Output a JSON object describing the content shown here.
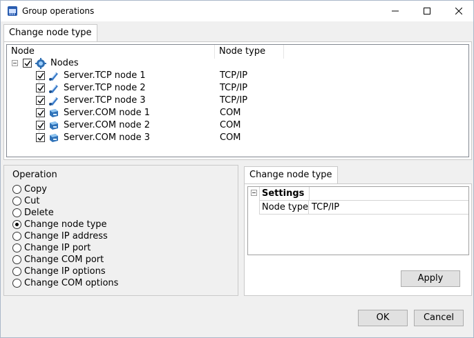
{
  "window": {
    "title": "Group operations",
    "icon": "network-app-icon",
    "controls": [
      "minimize-icon",
      "maximize-icon",
      "close-icon"
    ]
  },
  "top_tab": {
    "label": "Change node type"
  },
  "tree": {
    "columns": [
      "Node",
      "Node type"
    ],
    "root": {
      "label": "Nodes",
      "checked": true,
      "expanded": true
    },
    "children": [
      {
        "label": "Server.TCP node 1",
        "type": "TCP/IP",
        "checked": true,
        "icon": "tcp-node-icon"
      },
      {
        "label": "Server.TCP node 2",
        "type": "TCP/IP",
        "checked": true,
        "icon": "tcp-node-icon"
      },
      {
        "label": "Server.TCP node 3",
        "type": "TCP/IP",
        "checked": true,
        "icon": "tcp-node-icon"
      },
      {
        "label": "Server.COM node 1",
        "type": "COM",
        "checked": true,
        "icon": "com-node-icon"
      },
      {
        "label": "Server.COM node 2",
        "type": "COM",
        "checked": true,
        "icon": "com-node-icon"
      },
      {
        "label": "Server.COM node 3",
        "type": "COM",
        "checked": true,
        "icon": "com-node-icon"
      }
    ]
  },
  "operation": {
    "title": "Operation",
    "options": [
      {
        "label": "Copy",
        "selected": false
      },
      {
        "label": "Cut",
        "selected": false
      },
      {
        "label": "Delete",
        "selected": false
      },
      {
        "label": "Change node type",
        "selected": true
      },
      {
        "label": "Change IP address",
        "selected": false
      },
      {
        "label": "Change IP port",
        "selected": false
      },
      {
        "label": "Change COM port",
        "selected": false
      },
      {
        "label": "Change IP options",
        "selected": false
      },
      {
        "label": "Change COM options",
        "selected": false
      }
    ]
  },
  "right_tab": {
    "label": "Change node type"
  },
  "settings": {
    "category": "Settings",
    "rows": [
      {
        "name": "Node type",
        "value": "TCP/IP"
      }
    ]
  },
  "buttons": {
    "apply": "Apply",
    "ok": "OK",
    "cancel": "Cancel"
  }
}
